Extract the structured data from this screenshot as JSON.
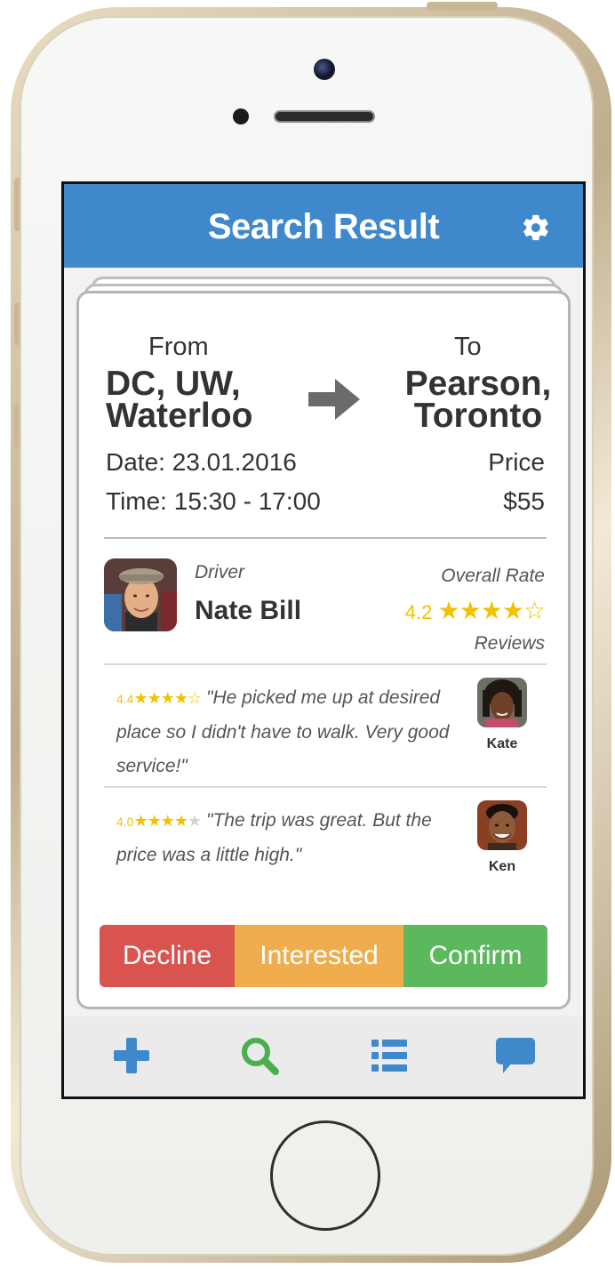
{
  "header": {
    "title": "Search Result",
    "settings_icon": "gear-icon"
  },
  "trip": {
    "from_label": "From",
    "from_city_line1": "DC, UW,",
    "from_city_line2": "Waterloo",
    "to_label": "To",
    "to_city_line1": "Pearson,",
    "to_city_line2": "Toronto",
    "date": "Date: 23.01.2016",
    "time": "Time: 15:30 - 17:00",
    "price_label": "Price",
    "price_value": "$55"
  },
  "driver": {
    "label": "Driver",
    "name": "Nate Bill",
    "overall_label": "Overall Rate",
    "rating": "4.2",
    "rating_stars": "★★★★☆",
    "reviews_label": "Reviews"
  },
  "reviews": [
    {
      "score": "4.4",
      "stars_filled": "★★★★",
      "stars_empty": "☆",
      "text": "\"He picked me up at desired place so I didn't have to walk. Very good service!\"",
      "reviewer": "Kate"
    },
    {
      "score": "4.0",
      "stars_filled": "★★★★",
      "stars_empty": "★",
      "text": "\"The trip was great. But the price was a little high.\"",
      "reviewer": "Ken"
    }
  ],
  "actions": {
    "decline": "Decline",
    "interested": "Interested",
    "confirm": "Confirm"
  },
  "tabbar": [
    "plus-icon",
    "search-icon",
    "list-icon",
    "chat-icon"
  ],
  "colors": {
    "header": "#3f88cc",
    "decline": "#d9534f",
    "interested": "#f0ad4e",
    "confirm": "#5cb85c",
    "star": "#f2c200",
    "tab_add": "#3f88cc",
    "tab_search": "#4cae4c"
  }
}
